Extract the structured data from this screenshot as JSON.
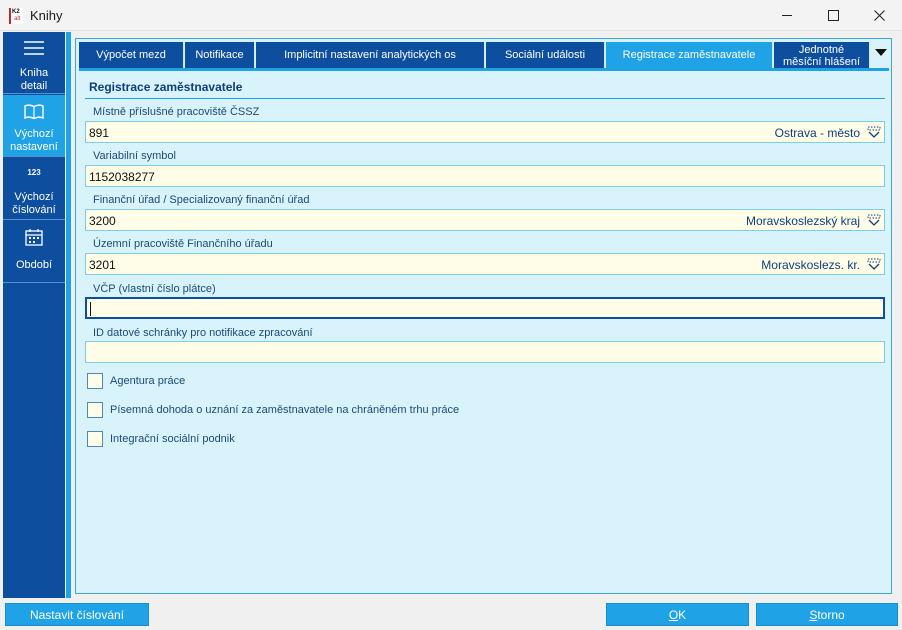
{
  "window": {
    "title": "Knihy",
    "icon_text_top": "K2",
    "icon_text_bottom": "alt"
  },
  "sidebar": {
    "items": [
      {
        "label_line1": "Kniha",
        "label_line2": "detail",
        "icon": "list-icon",
        "active": false
      },
      {
        "label_line1": "Výchozí",
        "label_line2": "nastavení",
        "icon": "book-icon",
        "active": true
      },
      {
        "label_line1": "Výchozí",
        "label_line2": "číslování",
        "icon": "numbering-icon",
        "icon_text": "123",
        "active": false
      },
      {
        "label_line1": "Období",
        "label_line2": "",
        "icon": "calendar-icon",
        "active": false
      }
    ]
  },
  "tabs": [
    {
      "label": "Výpočet mezd",
      "active": false
    },
    {
      "label": "Notifikace",
      "active": false
    },
    {
      "label": "Implicitní nastavení analytických os",
      "active": false
    },
    {
      "label": "Sociální události",
      "active": false
    },
    {
      "label": "Registrace zaměstnavatele",
      "active": true
    },
    {
      "label_line1": "Jednotné",
      "label_line2": "měsíční hlášení",
      "active": false
    }
  ],
  "section": {
    "title": "Registrace zaměstnavatele"
  },
  "fields": [
    {
      "label": "Místně příslušné pracoviště ČSSZ",
      "value": "891",
      "description": "Ostrava - město"
    },
    {
      "label": "Variabilní symbol",
      "value": "1152038277"
    },
    {
      "label": "Finanční úřad / Specializovaný finanční úřad",
      "value": "3200",
      "description": "Moravskoslezský kraj"
    },
    {
      "label": "Územní pracoviště Finančního úřadu",
      "value": "3201",
      "description": "Moravskoslezs. kr."
    },
    {
      "label": "VČP (vlastní číslo plátce)",
      "value": ""
    },
    {
      "label": "ID datové schránky pro notifikace zpracování",
      "value": ""
    }
  ],
  "checkboxes": [
    {
      "label": "Agentura práce",
      "checked": false
    },
    {
      "label": "Písemná dohoda o uznání za zaměstnavatele na chráněném trhu práce",
      "checked": false
    },
    {
      "label": "Integrační sociální podnik",
      "checked": false
    }
  ],
  "buttons": {
    "set_numbering": "Nastavit číslování",
    "ok_underlined": "O",
    "ok_rest": "K",
    "cancel_underlined": "S",
    "cancel_rest": "torno"
  },
  "colors": {
    "sidebar_bg": "#0d4f9e",
    "accent": "#1fa3e6",
    "panel_bg": "#d8f3fb",
    "field_bg": "#fffde8"
  }
}
